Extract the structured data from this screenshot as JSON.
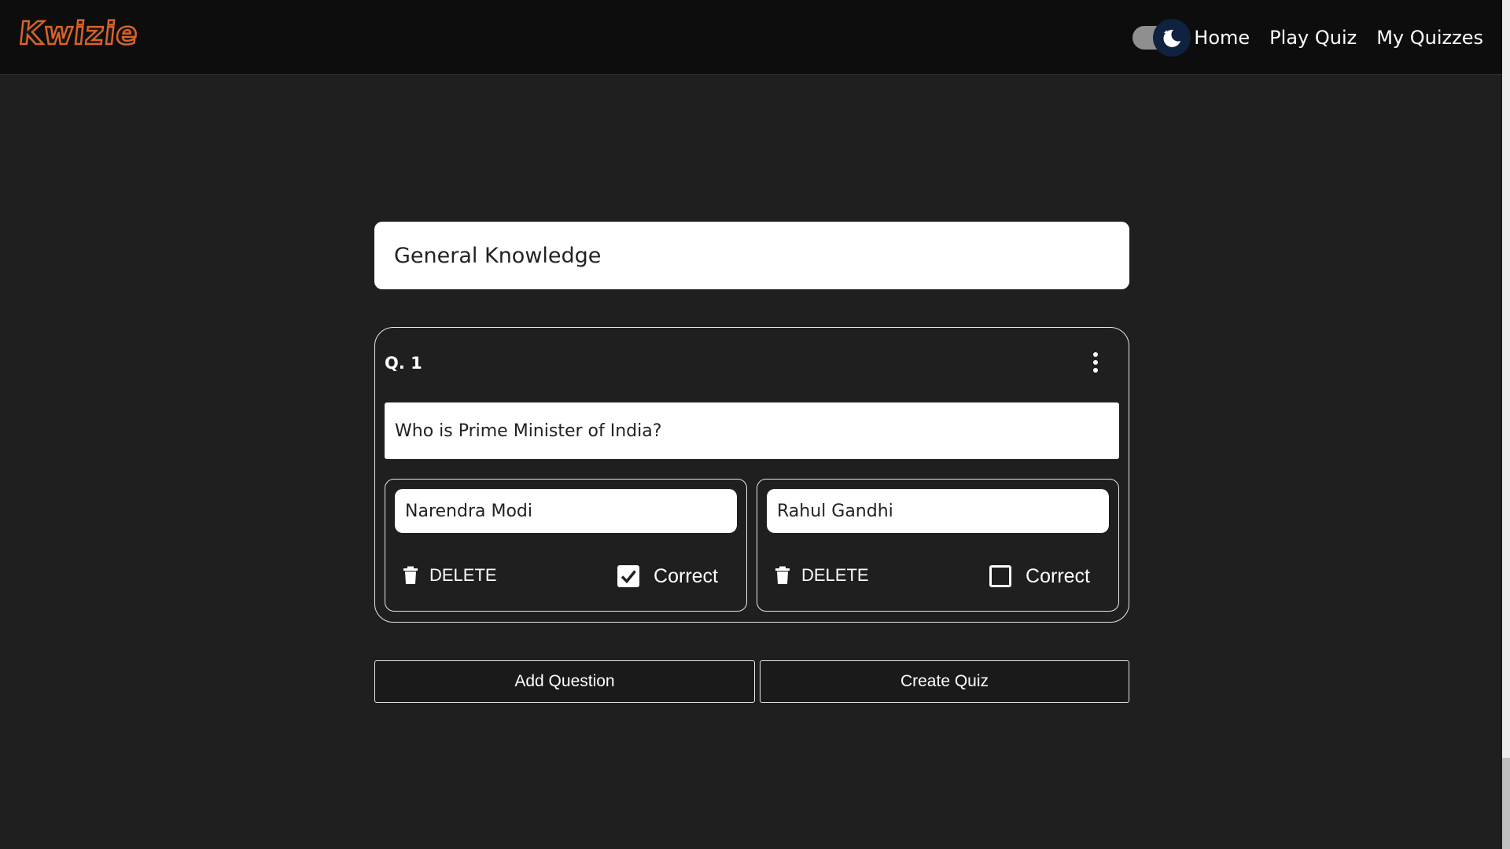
{
  "app": {
    "logo_text": "Kwizie"
  },
  "nav": {
    "links": [
      "Home",
      "Play Quiz",
      "My Quizzes"
    ],
    "theme": "dark"
  },
  "quiz": {
    "title_value": "General Knowledge",
    "questions": [
      {
        "number_label": "Q. 1",
        "text_value": "Who is Prime Minister of India?",
        "options": [
          {
            "value": "Narendra Modi",
            "delete_label": "DELETE",
            "correct_label": "Correct",
            "correct": true
          },
          {
            "value": "Rahul Gandhi",
            "delete_label": "DELETE",
            "correct_label": "Correct",
            "correct": false
          }
        ]
      }
    ]
  },
  "actions": {
    "add_question": "Add Question",
    "create_quiz": "Create Quiz"
  },
  "colors": {
    "background": "#1f1f1f",
    "navbar": "#0d0d0d",
    "logo": "#d9622b",
    "toggle_knob": "#0f2240"
  },
  "icons": [
    "moon-icon",
    "more-vertical-icon",
    "trash-icon",
    "checkmark-icon"
  ]
}
